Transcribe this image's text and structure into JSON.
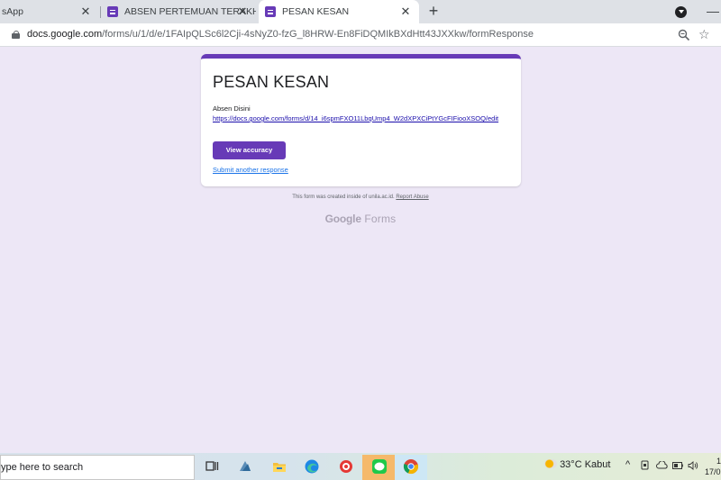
{
  "browser": {
    "tabs": [
      {
        "label": "sApp"
      },
      {
        "label": "ABSEN PERTEMUAN TERAKHIR"
      },
      {
        "label": "PESAN KESAN"
      }
    ],
    "new_tab_label": "+",
    "close_label": "✕",
    "minimize_label": "—",
    "url_host": "docs.google.com",
    "url_path": "/forms/u/1/d/e/1FAIpQLSc6l2Cji-4sNyZ0-fzG_l8HRW-En8FiDQMIkBXdHtt43JXXkw/formResponse"
  },
  "form": {
    "title": "PESAN KESAN",
    "message": "Absen Disini",
    "link": "https://docs.google.com/forms/d/14_i6spmFXO11LbqUmp4_W2dXPXCiPtYGcFIFiooXSOQ/edit",
    "view_button": "View accuracy",
    "another_link": "Submit another response",
    "accent_color": "#673ab7"
  },
  "footer": {
    "note": "This form was created inside of unila.ac.id.",
    "report_abuse": "Report Abuse",
    "brand_google": "Google",
    "brand_forms": "Forms"
  },
  "taskbar": {
    "search_text": "ype here to search",
    "weather_temp": "33°C",
    "weather_desc": "Kabut",
    "tray_chevron": "^",
    "clock_time": "1",
    "clock_date": "17/0"
  }
}
